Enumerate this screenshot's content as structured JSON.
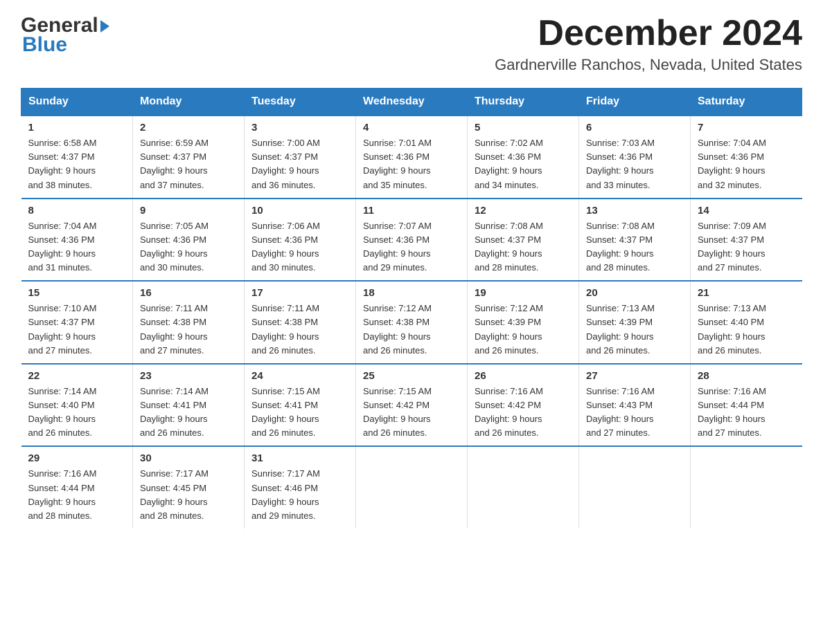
{
  "logo": {
    "general": "General",
    "blue": "Blue",
    "triangle": "▼"
  },
  "header": {
    "month_year": "December 2024",
    "location": "Gardnerville Ranchos, Nevada, United States"
  },
  "weekdays": [
    "Sunday",
    "Monday",
    "Tuesday",
    "Wednesday",
    "Thursday",
    "Friday",
    "Saturday"
  ],
  "weeks": [
    [
      {
        "day": 1,
        "sunrise": "6:58 AM",
        "sunset": "4:37 PM",
        "daylight": "9 hours and 38 minutes."
      },
      {
        "day": 2,
        "sunrise": "6:59 AM",
        "sunset": "4:37 PM",
        "daylight": "9 hours and 37 minutes."
      },
      {
        "day": 3,
        "sunrise": "7:00 AM",
        "sunset": "4:37 PM",
        "daylight": "9 hours and 36 minutes."
      },
      {
        "day": 4,
        "sunrise": "7:01 AM",
        "sunset": "4:36 PM",
        "daylight": "9 hours and 35 minutes."
      },
      {
        "day": 5,
        "sunrise": "7:02 AM",
        "sunset": "4:36 PM",
        "daylight": "9 hours and 34 minutes."
      },
      {
        "day": 6,
        "sunrise": "7:03 AM",
        "sunset": "4:36 PM",
        "daylight": "9 hours and 33 minutes."
      },
      {
        "day": 7,
        "sunrise": "7:04 AM",
        "sunset": "4:36 PM",
        "daylight": "9 hours and 32 minutes."
      }
    ],
    [
      {
        "day": 8,
        "sunrise": "7:04 AM",
        "sunset": "4:36 PM",
        "daylight": "9 hours and 31 minutes."
      },
      {
        "day": 9,
        "sunrise": "7:05 AM",
        "sunset": "4:36 PM",
        "daylight": "9 hours and 30 minutes."
      },
      {
        "day": 10,
        "sunrise": "7:06 AM",
        "sunset": "4:36 PM",
        "daylight": "9 hours and 30 minutes."
      },
      {
        "day": 11,
        "sunrise": "7:07 AM",
        "sunset": "4:36 PM",
        "daylight": "9 hours and 29 minutes."
      },
      {
        "day": 12,
        "sunrise": "7:08 AM",
        "sunset": "4:37 PM",
        "daylight": "9 hours and 28 minutes."
      },
      {
        "day": 13,
        "sunrise": "7:08 AM",
        "sunset": "4:37 PM",
        "daylight": "9 hours and 28 minutes."
      },
      {
        "day": 14,
        "sunrise": "7:09 AM",
        "sunset": "4:37 PM",
        "daylight": "9 hours and 27 minutes."
      }
    ],
    [
      {
        "day": 15,
        "sunrise": "7:10 AM",
        "sunset": "4:37 PM",
        "daylight": "9 hours and 27 minutes."
      },
      {
        "day": 16,
        "sunrise": "7:11 AM",
        "sunset": "4:38 PM",
        "daylight": "9 hours and 27 minutes."
      },
      {
        "day": 17,
        "sunrise": "7:11 AM",
        "sunset": "4:38 PM",
        "daylight": "9 hours and 26 minutes."
      },
      {
        "day": 18,
        "sunrise": "7:12 AM",
        "sunset": "4:38 PM",
        "daylight": "9 hours and 26 minutes."
      },
      {
        "day": 19,
        "sunrise": "7:12 AM",
        "sunset": "4:39 PM",
        "daylight": "9 hours and 26 minutes."
      },
      {
        "day": 20,
        "sunrise": "7:13 AM",
        "sunset": "4:39 PM",
        "daylight": "9 hours and 26 minutes."
      },
      {
        "day": 21,
        "sunrise": "7:13 AM",
        "sunset": "4:40 PM",
        "daylight": "9 hours and 26 minutes."
      }
    ],
    [
      {
        "day": 22,
        "sunrise": "7:14 AM",
        "sunset": "4:40 PM",
        "daylight": "9 hours and 26 minutes."
      },
      {
        "day": 23,
        "sunrise": "7:14 AM",
        "sunset": "4:41 PM",
        "daylight": "9 hours and 26 minutes."
      },
      {
        "day": 24,
        "sunrise": "7:15 AM",
        "sunset": "4:41 PM",
        "daylight": "9 hours and 26 minutes."
      },
      {
        "day": 25,
        "sunrise": "7:15 AM",
        "sunset": "4:42 PM",
        "daylight": "9 hours and 26 minutes."
      },
      {
        "day": 26,
        "sunrise": "7:16 AM",
        "sunset": "4:42 PM",
        "daylight": "9 hours and 26 minutes."
      },
      {
        "day": 27,
        "sunrise": "7:16 AM",
        "sunset": "4:43 PM",
        "daylight": "9 hours and 27 minutes."
      },
      {
        "day": 28,
        "sunrise": "7:16 AM",
        "sunset": "4:44 PM",
        "daylight": "9 hours and 27 minutes."
      }
    ],
    [
      {
        "day": 29,
        "sunrise": "7:16 AM",
        "sunset": "4:44 PM",
        "daylight": "9 hours and 28 minutes."
      },
      {
        "day": 30,
        "sunrise": "7:17 AM",
        "sunset": "4:45 PM",
        "daylight": "9 hours and 28 minutes."
      },
      {
        "day": 31,
        "sunrise": "7:17 AM",
        "sunset": "4:46 PM",
        "daylight": "9 hours and 29 minutes."
      },
      null,
      null,
      null,
      null
    ]
  ],
  "labels": {
    "sunrise": "Sunrise:",
    "sunset": "Sunset:",
    "daylight": "Daylight:"
  }
}
